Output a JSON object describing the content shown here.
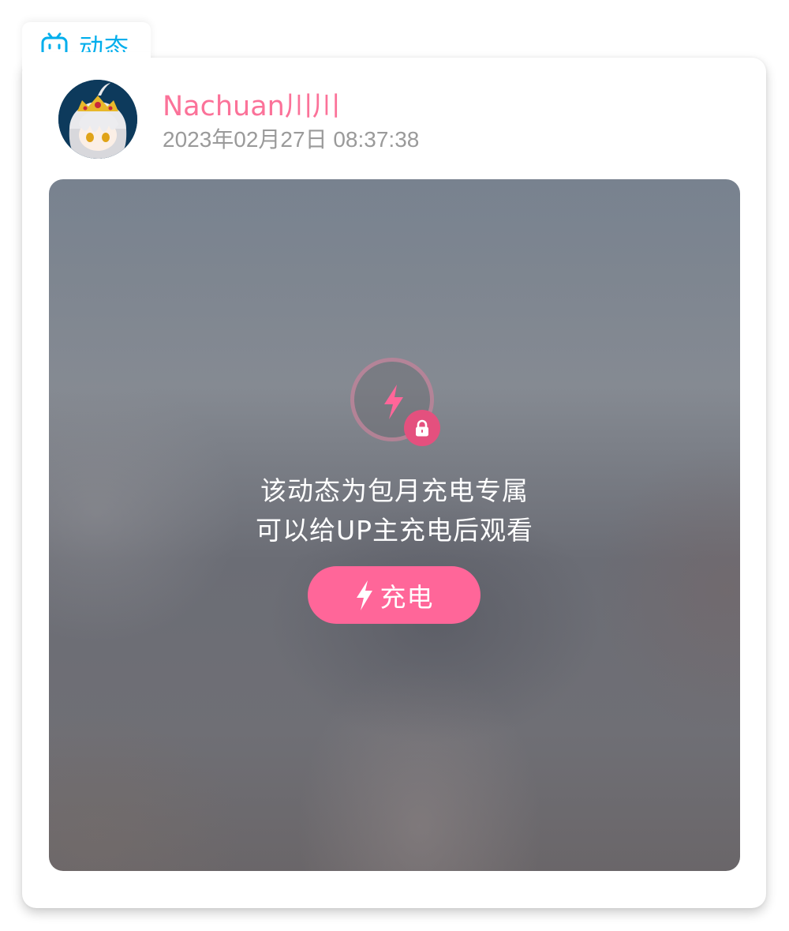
{
  "tab": {
    "label": "动态",
    "icon": "bilibili-tv-icon",
    "color": "#00aeec"
  },
  "post": {
    "username": "Nachuan川川",
    "timestamp": "2023年02月27日 08:37:38",
    "avatar_icon": "avatar"
  },
  "locked": {
    "message_line1": "该动态为包月充电专属",
    "message_line2": "可以给UP主充电后观看",
    "button_label": "充电",
    "icons": [
      "bolt-icon",
      "lock-icon"
    ],
    "accent_color": "#ff6699"
  },
  "colors": {
    "username": "#fb7299",
    "timestamp": "#9a9a9a"
  }
}
